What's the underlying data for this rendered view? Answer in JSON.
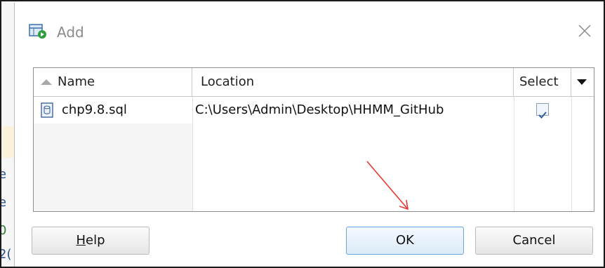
{
  "background": {
    "left_chars": [
      "e",
      "e",
      "0",
      "2("
    ]
  },
  "dialog": {
    "title": "Add",
    "icons": {
      "title": "add-database-icon",
      "close": "close-icon"
    },
    "table": {
      "columns": {
        "name": "Name",
        "location": "Location",
        "select": "Select"
      },
      "rows": [
        {
          "name": "chp9.8.sql",
          "location": "C:\\Users\\Admin\\Desktop\\HHMM_GitHub",
          "selected": true
        }
      ]
    },
    "buttons": {
      "help_mnemonic": "H",
      "help_rest": "elp",
      "ok": "OK",
      "cancel": "Cancel"
    }
  },
  "colors": {
    "annotation_arrow": "#e53935",
    "ok_border": "#6ca3d8"
  }
}
